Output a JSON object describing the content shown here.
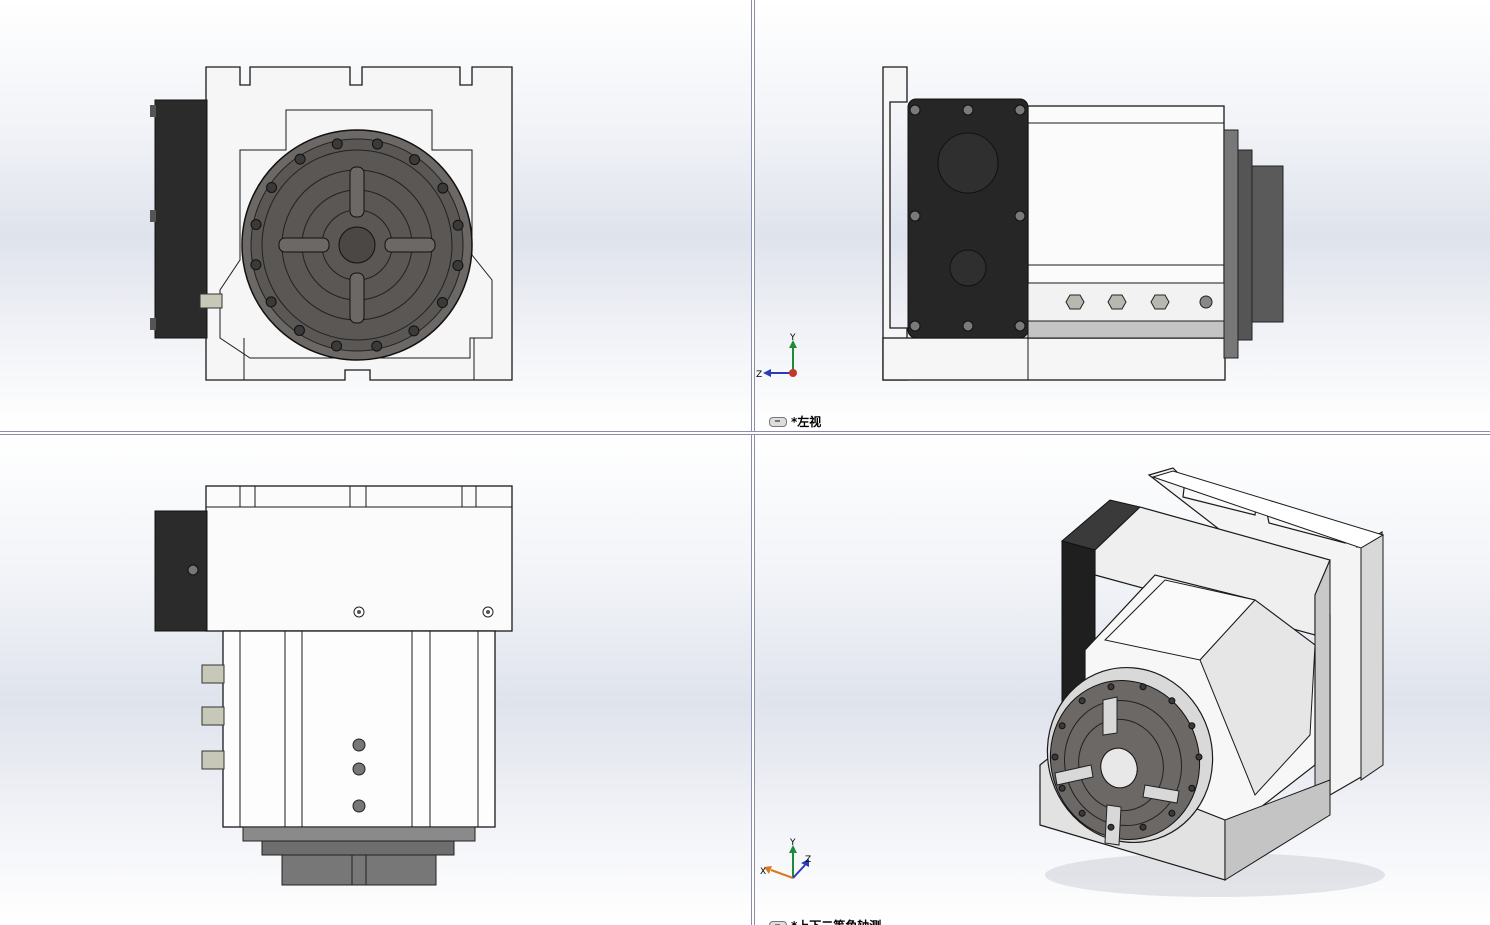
{
  "views": {
    "front": {
      "label": ""
    },
    "left": {
      "label": "*左视"
    },
    "top": {
      "label": ""
    },
    "iso": {
      "label": "*上下二等角轴测"
    }
  },
  "triad": {
    "x": "X",
    "y": "Y",
    "z": "Z"
  },
  "colors": {
    "body": "#f4f4f4",
    "dark": "#2b2b2b",
    "chuck": "#6b6866",
    "outline": "#1a1a1a",
    "axis_x": "#c0392b",
    "axis_y": "#1e8a3a",
    "axis_z": "#2c3cb8"
  }
}
